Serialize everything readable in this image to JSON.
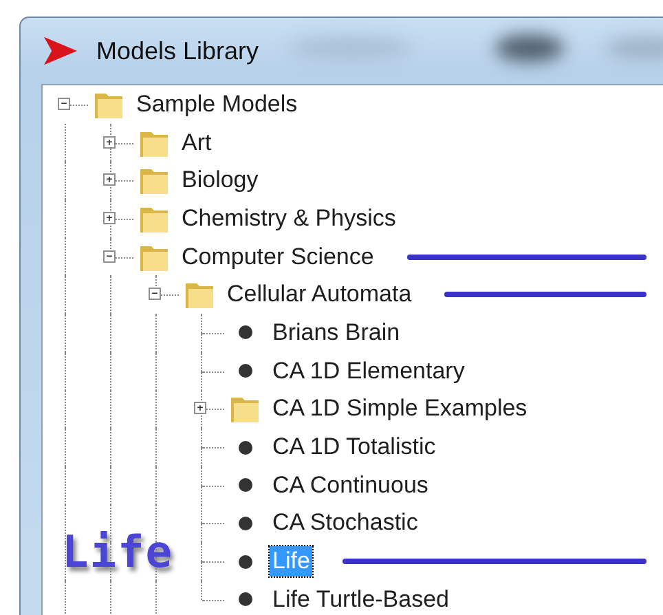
{
  "window": {
    "title": "Models Library"
  },
  "tree": [
    {
      "label": "Sample Models",
      "kind": "folder",
      "expanded": true,
      "selected": false,
      "children": [
        {
          "label": "Art",
          "kind": "folder",
          "expanded": false,
          "selected": false
        },
        {
          "label": "Biology",
          "kind": "folder",
          "expanded": false,
          "selected": false
        },
        {
          "label": "Chemistry & Physics",
          "kind": "folder",
          "expanded": false,
          "selected": false
        },
        {
          "label": "Computer Science",
          "kind": "folder",
          "expanded": true,
          "selected": false,
          "underlined": true,
          "children": [
            {
              "label": "Cellular Automata",
              "kind": "folder",
              "expanded": true,
              "selected": false,
              "underlined": true,
              "children": [
                {
                  "label": "Brians Brain",
                  "kind": "model",
                  "selected": false
                },
                {
                  "label": "CA 1D Elementary",
                  "kind": "model",
                  "selected": false
                },
                {
                  "label": "CA 1D Simple Examples",
                  "kind": "folder",
                  "expanded": false,
                  "selected": false
                },
                {
                  "label": "CA 1D Totalistic",
                  "kind": "model",
                  "selected": false
                },
                {
                  "label": "CA Continuous",
                  "kind": "model",
                  "selected": false
                },
                {
                  "label": "CA Stochastic",
                  "kind": "model",
                  "selected": false
                },
                {
                  "label": "Life",
                  "kind": "model",
                  "selected": true,
                  "underlined": true
                },
                {
                  "label": "Life Turtle-Based",
                  "kind": "model",
                  "selected": false
                }
              ]
            }
          ]
        }
      ]
    }
  ],
  "annotation": {
    "text": "Life"
  }
}
